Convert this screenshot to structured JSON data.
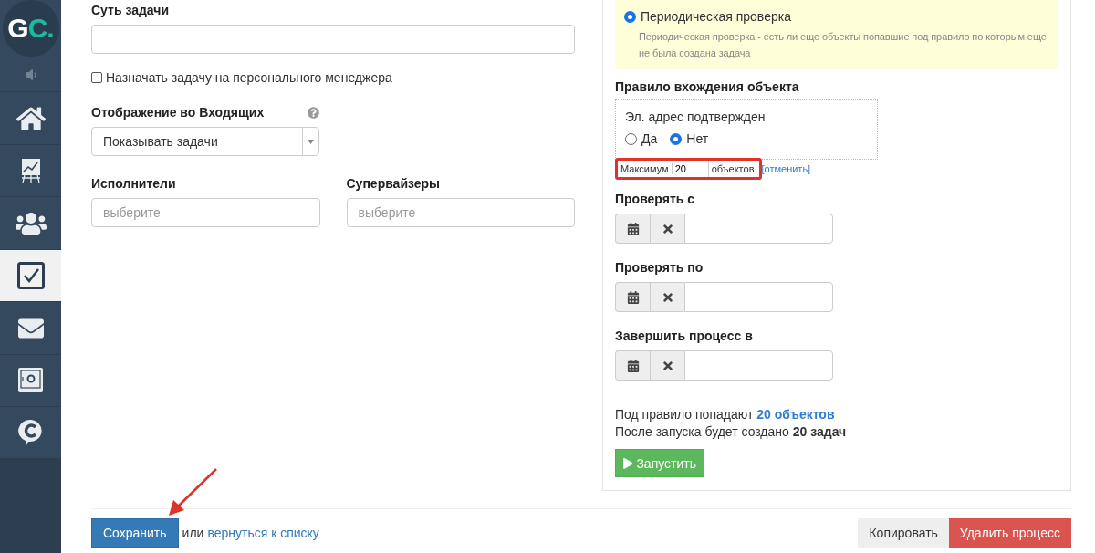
{
  "logo": {
    "primary": "G",
    "accent": "C."
  },
  "sidebar": {
    "items": [
      {
        "kind": "speaker",
        "selected": false
      },
      {
        "kind": "home",
        "selected": false
      },
      {
        "kind": "chart",
        "selected": false
      },
      {
        "kind": "users",
        "selected": false
      },
      {
        "kind": "tasks",
        "selected": true
      },
      {
        "kind": "mail",
        "selected": false
      },
      {
        "kind": "safe",
        "selected": false
      },
      {
        "kind": "chat",
        "selected": false
      }
    ]
  },
  "task_essence": {
    "label": "Суть задачи"
  },
  "assign_personal_manager": {
    "label": "Назначать задачу на персонального менеджера",
    "checked": false
  },
  "inbox_display": {
    "label": "Отображение во Входящих",
    "value": "Показывать задачи"
  },
  "executors": {
    "label": "Исполнители",
    "placeholder": "выберите"
  },
  "supervisors": {
    "label": "Супервайзеры",
    "placeholder": "выберите"
  },
  "periodic_check": {
    "label": "Периодическая проверка",
    "selected": true,
    "description": "Периодическая проверка - есть ли еще объекты попавшие под правило по которым еще не была создана задача"
  },
  "rule": {
    "title": "Правило вхождения объекта",
    "condition": "Эл. адрес подтвержден",
    "options": [
      {
        "label": "Да",
        "selected": false
      },
      {
        "label": "Нет",
        "selected": true
      }
    ]
  },
  "maximum": {
    "prefix": "Максимум",
    "value": "20",
    "suffix": "объектов",
    "cancel": "[отменить]"
  },
  "dates": [
    {
      "label": "Проверять с"
    },
    {
      "label": "Проверять по"
    },
    {
      "label": "Завершить процесс в"
    }
  ],
  "summary": {
    "matched_text": "Под правило попадают",
    "matched_link": "20 объектов",
    "created_text": "После запуска будет создано **20 задач**"
  },
  "run_button": {
    "label": "Запустить"
  },
  "footer": {
    "save": "Сохранить",
    "or": "или",
    "back_link": "вернуться к списку",
    "copy": "Копировать",
    "delete": "Удалить процесс"
  }
}
